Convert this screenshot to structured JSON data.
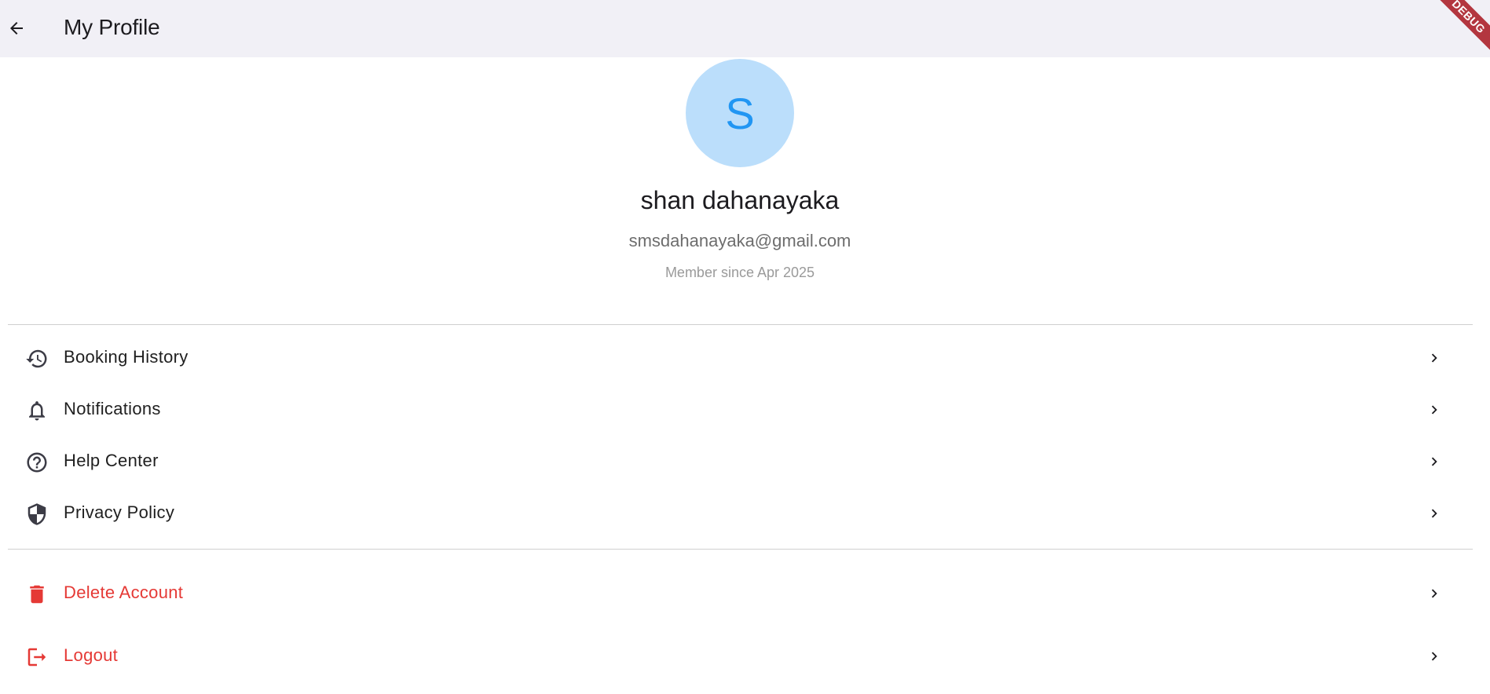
{
  "appbar": {
    "title": "My Profile",
    "debug_badge": "DEBUG",
    "back_icon": "arrow-back-icon"
  },
  "profile": {
    "avatar_initial": "S",
    "name": "shan dahanayaka",
    "email": "smsdahanayaka@gmail.com",
    "member_since": "Member since Apr 2025"
  },
  "menu": {
    "items": [
      {
        "label": "Booking History",
        "icon": "history-icon"
      },
      {
        "label": "Notifications",
        "icon": "bell-icon"
      },
      {
        "label": "Help Center",
        "icon": "help-circle-icon"
      },
      {
        "label": "Privacy Policy",
        "icon": "shield-icon"
      }
    ],
    "danger_items": [
      {
        "label": "Delete Account",
        "icon": "trash-icon"
      },
      {
        "label": "Logout",
        "icon": "logout-icon"
      }
    ]
  },
  "colors": {
    "appbar_bg": "#f1f0f6",
    "avatar_bg": "#bbdefb",
    "avatar_text": "#2196f3",
    "danger": "#e53935",
    "icon": "#3c3c46"
  }
}
